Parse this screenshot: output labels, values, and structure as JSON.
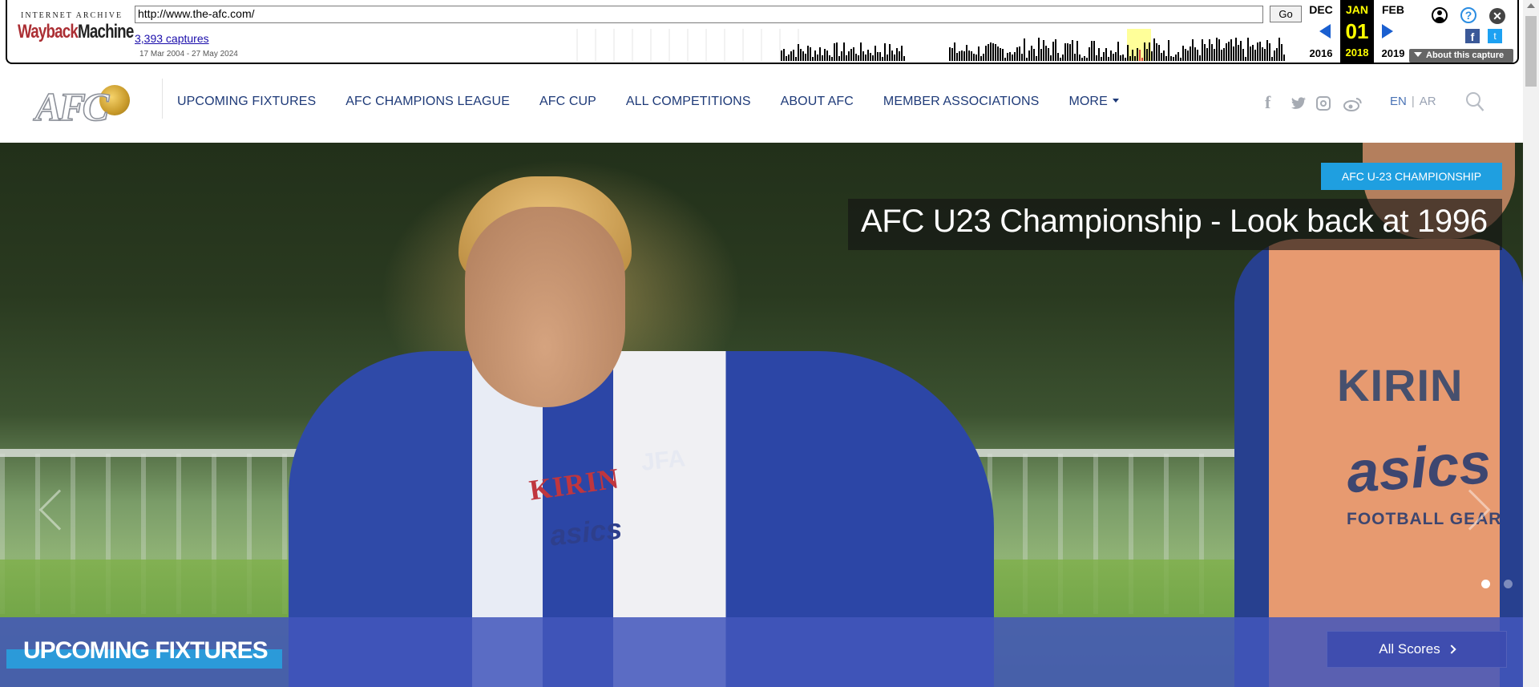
{
  "wayback": {
    "logo_top": "INTERNET ARCHIVE",
    "logo_main_a": "Wayback",
    "logo_main_b": "Machine",
    "url": "http://www.the-afc.com/",
    "go_label": "Go",
    "captures": "3,393 captures",
    "date_range": "17 Mar 2004 - 27 May 2024",
    "prev_month": "DEC",
    "cur_month": "JAN",
    "next_month": "FEB",
    "cur_day": "01",
    "prev_year": "2016",
    "cur_year": "2018",
    "next_year": "2019",
    "about": "About this capture",
    "help_glyph": "?",
    "close_glyph": "✕",
    "fb_glyph": "f",
    "tw_glyph": "t",
    "icons": [
      "user-icon",
      "help-icon",
      "close-icon",
      "facebook-icon",
      "twitter-icon"
    ]
  },
  "header": {
    "logo_text": "AFC",
    "nav": [
      {
        "label": "UPCOMING FIXTURES"
      },
      {
        "label": "AFC CHAMPIONS LEAGUE"
      },
      {
        "label": "AFC CUP"
      },
      {
        "label": "ALL COMPETITIONS"
      },
      {
        "label": "ABOUT AFC"
      },
      {
        "label": "MEMBER ASSOCIATIONS"
      },
      {
        "label": "MORE"
      }
    ],
    "social_fb": "f",
    "lang_en": "EN",
    "lang_sep": "|",
    "lang_ar": "AR"
  },
  "hero": {
    "badge": "AFC U-23 CHAMPIONSHIP",
    "title": "AFC U23 Championship - Look back at 1996",
    "slides_total": 2,
    "slide_active": 1,
    "photo_text": {
      "kirin": "KIRIN",
      "asics": "asics",
      "jfa": "JFA",
      "football_gear": "FOOTBALL GEAR"
    }
  },
  "fixtures": {
    "title": "UPCOMING FIXTURES",
    "all_scores": "All Scores"
  },
  "colors": {
    "nav_text": "#1e3a78",
    "badge": "#1f9fe0",
    "fixtures_bar": "#4256bc",
    "wayback_current": "#ffff00"
  }
}
